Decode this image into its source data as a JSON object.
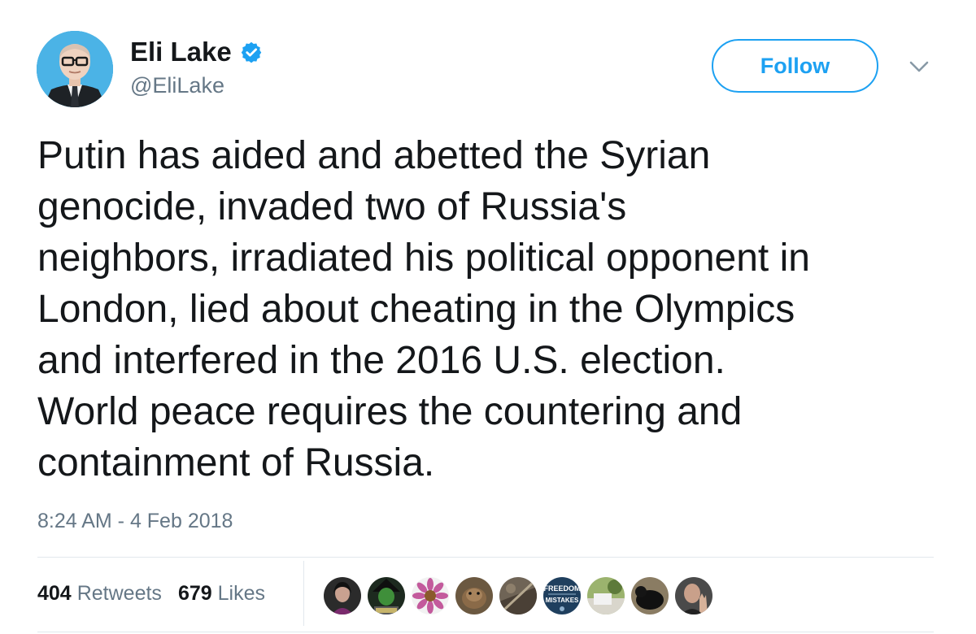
{
  "author": {
    "name": "Eli Lake",
    "handle": "@EliLake",
    "verified": true,
    "avatar_icon": "avatar-photo"
  },
  "actions": {
    "follow_label": "Follow",
    "menu_icon": "chevron-down-icon"
  },
  "tweet": {
    "text": "Putin has aided and abetted the Syrian\ngenocide, invaded two of Russia's\nneighbors, irradiated his political opponent in\nLondon, lied about cheating in the Olympics\nand interfered in the 2016 U.S. election.\nWorld peace requires the countering and\ncontainment of Russia.",
    "timestamp": "8:24 AM - 4 Feb 2018"
  },
  "stats": {
    "retweets_count": "404",
    "retweets_label": "Retweets",
    "likes_count": "679",
    "likes_label": "Likes"
  },
  "likers_banner_text": [
    "FREEDOM",
    "MISTAKES"
  ],
  "colors": {
    "accent": "#1da1f2",
    "text": "#14171a",
    "secondary": "#657786",
    "divider": "#e1e8ed"
  }
}
